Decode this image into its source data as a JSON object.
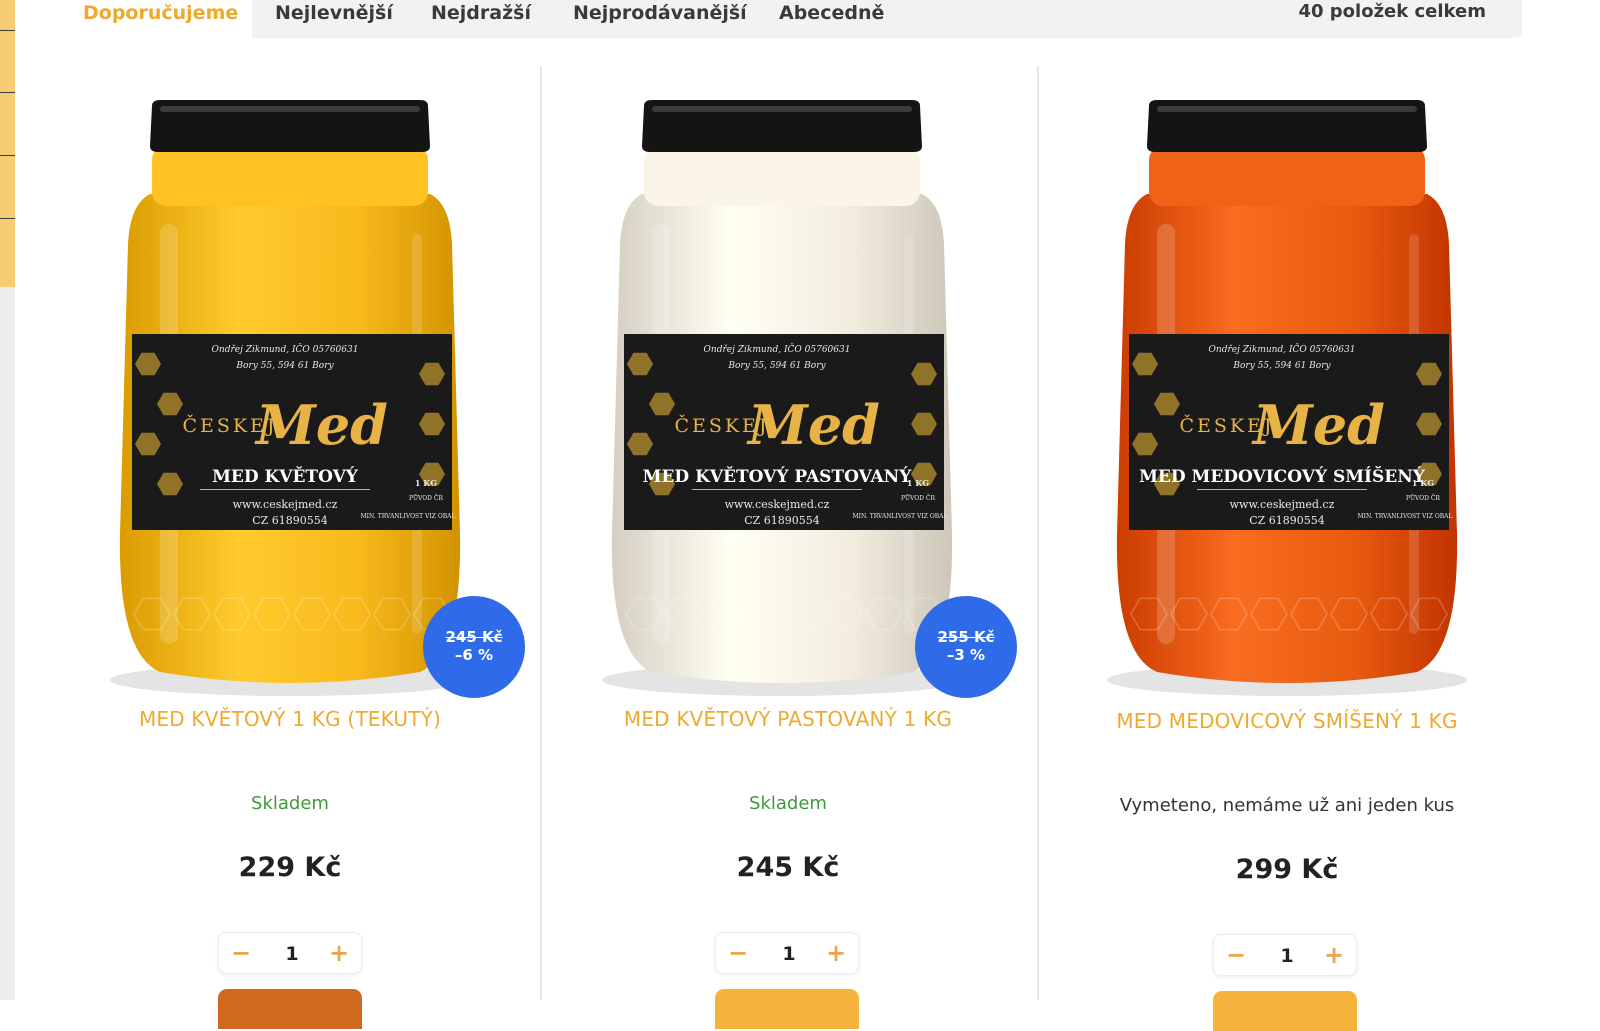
{
  "sort": {
    "tabs": [
      {
        "label": "Doporučujeme",
        "active": true
      },
      {
        "label": "Nejlevnější",
        "active": false
      },
      {
        "label": "Nejdražší",
        "active": false
      },
      {
        "label": "Nejprodávanější",
        "active": false
      },
      {
        "label": "Abecedně",
        "active": false
      }
    ],
    "count_label": "40 položek celkem"
  },
  "products": [
    {
      "name": "MED KVĚTOVÝ 1 KG (TEKUTÝ)",
      "label_name": "MED KVĚTOVÝ",
      "stock": "Skladem",
      "price": "229 Kč",
      "old_price": "245 Kč",
      "discount": "–6 %",
      "qty": "1",
      "honey_color": "#f8b91c",
      "cart_color": "#cf6a1e"
    },
    {
      "name": "MED KVĚTOVÝ PASTOVANÝ 1 KG",
      "label_name": "MED KVĚTOVÝ PASTOVANÝ",
      "stock": "Skladem",
      "price": "245 Kč",
      "old_price": "255 Kč",
      "discount": "–3 %",
      "qty": "1",
      "honey_color": "#f3ede0",
      "cart_color": "#f4b43c"
    },
    {
      "name": "MED MEDOVICOVÝ SMÍŠENÝ 1 KG",
      "label_name": "MED MEDOVICOVÝ SMÍŠENÝ",
      "stock": "Vymeteno, nemáme už ani jeden kus",
      "price": "299 Kč",
      "qty": "1",
      "honey_color": "#e85a0e",
      "cart_color": "#f4b43c"
    }
  ],
  "jar_label": {
    "owner": "Ondřej Zikmund, IČO 05760631",
    "address": "Bory 55, 594 61 Bory",
    "brand_prefix": "ČESKEJ",
    "brand_script": "Med",
    "website": "www.ceskejmed.cz",
    "country_code": "CZ 61890554",
    "weight": "1 KG",
    "origin": "PŮVOD ČR",
    "shelf": "MIN. TRVANLIVOST VIZ OBAL"
  },
  "controls": {
    "minus": "−",
    "plus": "+"
  },
  "colors": {
    "accent": "#efa92e",
    "badge": "#2f6be8",
    "in_stock": "#3f9a3a"
  }
}
